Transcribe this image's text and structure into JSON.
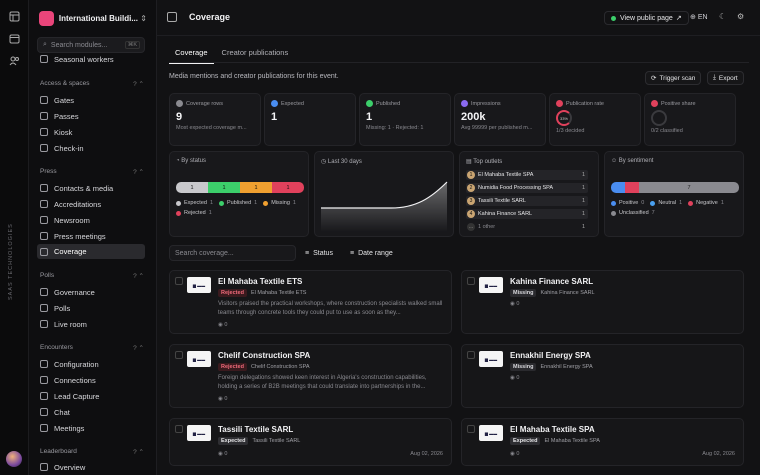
{
  "brand": {
    "org_name": "International Buildi...",
    "rail_text": "SAAS TECHNOLOGIES"
  },
  "sidebar": {
    "search_placeholder": "Search modules...",
    "search_shortcut": "⌘K",
    "top_item": "Seasonal workers",
    "sections": [
      {
        "title": "Access & spaces",
        "items": [
          "Gates",
          "Passes",
          "Kiosk",
          "Check-in"
        ]
      },
      {
        "title": "Press",
        "items": [
          "Contacts & media",
          "Accreditations",
          "Newsroom",
          "Press meetings",
          "Coverage"
        ]
      },
      {
        "title": "Polls",
        "items": [
          "Governance",
          "Polls",
          "Live room"
        ]
      },
      {
        "title": "Encounters",
        "items": [
          "Configuration",
          "Connections",
          "Lead Capture",
          "Chat",
          "Meetings"
        ]
      },
      {
        "title": "Leaderboard",
        "items": [
          "Overview"
        ]
      }
    ]
  },
  "header": {
    "title": "Coverage",
    "view_public": "View public page",
    "lang": "EN"
  },
  "tabs": [
    "Coverage",
    "Creator publications"
  ],
  "description": "Media mentions and creator publications for this event.",
  "actions": {
    "trigger_scan": "Trigger scan",
    "export": "Export"
  },
  "stats": [
    {
      "label": "Coverage rows",
      "value": "9",
      "sub": "Most expected coverage m...",
      "color": "#8a8a90"
    },
    {
      "label": "Expected",
      "value": "1",
      "sub": "",
      "color": "#4a8df0"
    },
    {
      "label": "Published",
      "value": "1",
      "sub": "Missing: 1 · Rejected: 1",
      "color": "#3ccf6b"
    },
    {
      "label": "Impressions",
      "value": "200k",
      "sub": "Avg 99999 per published m...",
      "color": "#8a6af0"
    },
    {
      "label": "Publication rate",
      "value": "",
      "sub": "1/3 decided",
      "ring": "33%",
      "color": "#e0415c"
    },
    {
      "label": "Positive share",
      "value": "",
      "sub": "0/2 classified",
      "color": "#e0415c"
    }
  ],
  "status_panel": {
    "title": "By status",
    "segments": [
      {
        "value": "1",
        "color": "#c8c8cc"
      },
      {
        "value": "1",
        "color": "#3ccf6b"
      },
      {
        "value": "1",
        "color": "#f0a030"
      },
      {
        "value": "1",
        "color": "#e0415c"
      }
    ],
    "legend": [
      {
        "label": "Expected",
        "count": "1",
        "color": "#c8c8cc"
      },
      {
        "label": "Published",
        "count": "1",
        "color": "#3ccf6b"
      },
      {
        "label": "Missing",
        "count": "1",
        "color": "#f0a030"
      },
      {
        "label": "Rejected",
        "count": "1",
        "color": "#e0415c"
      }
    ]
  },
  "trend_panel": {
    "title": "Last 30 days"
  },
  "outlets_panel": {
    "title": "Top outlets",
    "rows": [
      {
        "rank": "1",
        "name": "El Mahaba Textile SPA",
        "count": "1"
      },
      {
        "rank": "2",
        "name": "Numidia Food Processing SPA",
        "count": "1"
      },
      {
        "rank": "3",
        "name": "Tassili Textile SARL",
        "count": "1"
      },
      {
        "rank": "4",
        "name": "Kahina Finance SARL",
        "count": "1"
      }
    ],
    "more": "1 other",
    "more_count": "1"
  },
  "sentiment_panel": {
    "title": "By sentiment",
    "bar_value": "7",
    "legend": [
      {
        "label": "Positive",
        "count": "0",
        "color": "#4a8df0"
      },
      {
        "label": "Neutral",
        "count": "1",
        "color": "#4aa0f0"
      },
      {
        "label": "Negative",
        "count": "1",
        "color": "#e0415c"
      },
      {
        "label": "Unclassified",
        "count": "7",
        "color": "#8a8a90"
      }
    ]
  },
  "filters": {
    "search_placeholder": "Search coverage...",
    "status": "Status",
    "date_range": "Date range"
  },
  "cards": [
    {
      "title": "El Mahaba Textile ETS",
      "status": "Rejected",
      "status_kind": "rej",
      "outlet": "El Mahaba Textile ETS",
      "excerpt": "Visitors praised the practical workshops, where construction specialists walked small teams through concrete tools they could put to use as soon as they...",
      "views": "0",
      "date": ""
    },
    {
      "title": "Kahina Finance SARL",
      "status": "Missing",
      "status_kind": "mis",
      "outlet": "Kahina Finance SARL",
      "excerpt": "",
      "views": "0",
      "date": ""
    },
    {
      "title": "Chelif Construction SPA",
      "status": "Rejected",
      "status_kind": "rej",
      "outlet": "Chelif Construction SPA",
      "excerpt": "Foreign delegations showed keen interest in Algeria's construction capabilities, holding a series of B2B meetings that could translate into partnerships in the...",
      "views": "0",
      "date": ""
    },
    {
      "title": "Ennakhil Energy SPA",
      "status": "Missing",
      "status_kind": "mis",
      "outlet": "Ennakhil Energy SPA",
      "excerpt": "",
      "views": "0",
      "date": ""
    },
    {
      "title": "Tassili Textile SARL",
      "status": "Expected",
      "status_kind": "exp",
      "outlet": "Tassili Textile SARL",
      "excerpt": "",
      "views": "0",
      "date": "Aug 02, 2026"
    },
    {
      "title": "El Mahaba Textile SPA",
      "status": "Expected",
      "status_kind": "exp",
      "outlet": "El Mahaba Textile SPA",
      "excerpt": "",
      "views": "0",
      "date": "Aug 02, 2026"
    }
  ]
}
